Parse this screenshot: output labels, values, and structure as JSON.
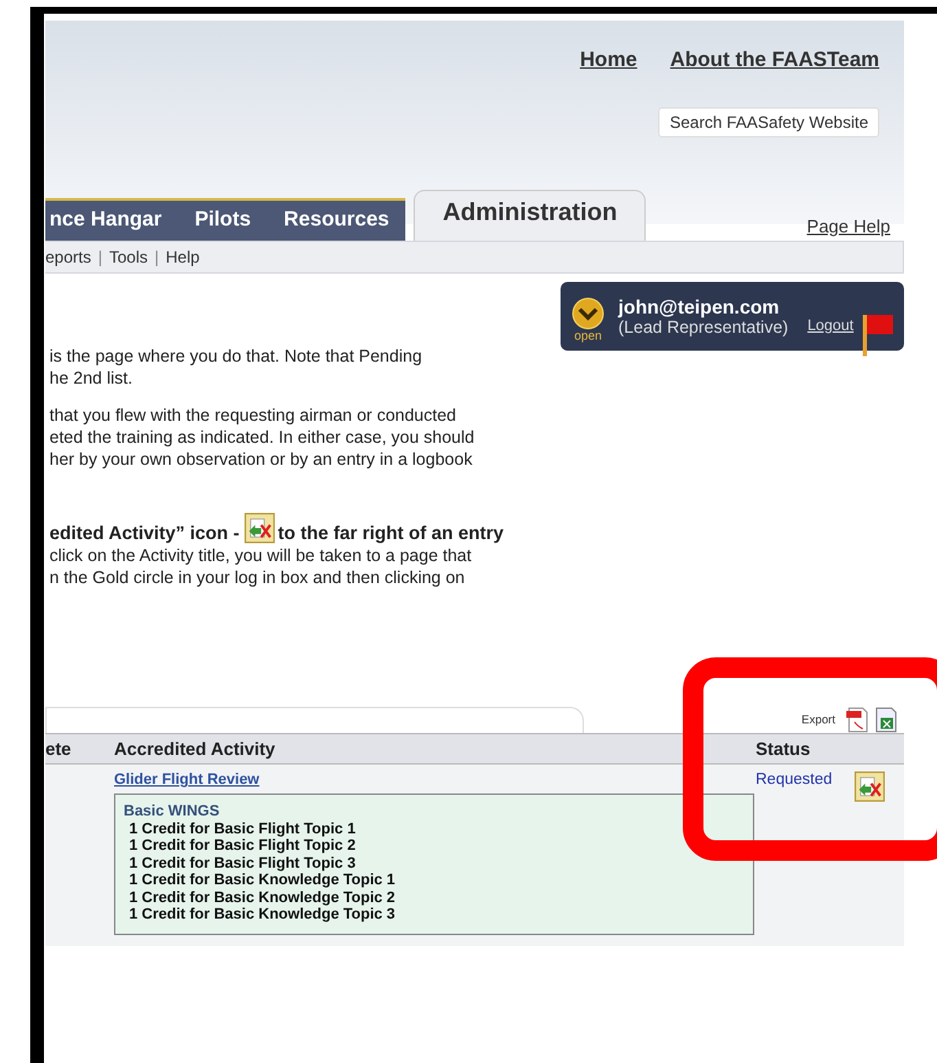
{
  "header": {
    "links": [
      "Home",
      "About the FAASTeam"
    ],
    "search_button": "Search FAASafety Website"
  },
  "nav": {
    "tabs": [
      {
        "label": "nce Hangar",
        "selected": false
      },
      {
        "label": "Pilots",
        "selected": false
      },
      {
        "label": "Resources",
        "selected": false
      },
      {
        "label": "Administration",
        "selected": true
      }
    ],
    "page_help": "Page Help"
  },
  "subnav": {
    "items": [
      "eports",
      "Tools",
      "Help"
    ],
    "separator": "|"
  },
  "user_box": {
    "badge": "open",
    "email": "john@teipen.com",
    "role": "(Lead Representative)",
    "logout": "Logout"
  },
  "content": {
    "paragraphs": [
      [
        "is the page where you do that. Note that Pending",
        "he 2nd list."
      ],
      [
        "that you flew with the requesting airman or conducted",
        "eted the training as indicated. In either case, you should",
        "her by your own observation or by an entry in a logbook"
      ]
    ],
    "instruction": {
      "before_icon": "edited Activity” icon -",
      "after_icon": "to the far right of an entry",
      "lines": [
        "click on the Activity title, you will be taken to a page that",
        "n the Gold circle in your log in box and then clicking on"
      ]
    }
  },
  "table": {
    "export_label": "Export",
    "columns": [
      "ete",
      "Accredited Activity",
      "Status"
    ],
    "rows": [
      {
        "activity": "Glider Flight Review",
        "program": "Basic WINGS",
        "credits": [
          "1 Credit for Basic Flight Topic 1",
          "1 Credit for Basic Flight Topic 2",
          "1 Credit for Basic Flight Topic 3",
          "1 Credit for Basic Knowledge Topic 1",
          "1 Credit for Basic Knowledge Topic 2",
          "1 Credit for Basic Knowledge Topic 3"
        ],
        "status": "Requested"
      }
    ]
  }
}
